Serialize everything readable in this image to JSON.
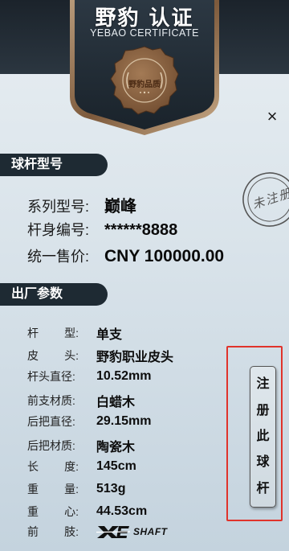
{
  "brand": {
    "title_cn": "野豹 认证",
    "title_en": "YEBAO CERTIFICATE",
    "seal_text": "野豹品质"
  },
  "close_label": "×",
  "stamp": {
    "text": "未注册"
  },
  "model_section": {
    "title": "球杆型号",
    "rows": [
      {
        "label": "系列型号:",
        "value": "巅峰"
      },
      {
        "label": "杆身编号:",
        "value": "******8888"
      },
      {
        "label": "统一售价:",
        "value": "CNY 100000.00"
      }
    ]
  },
  "factory_section": {
    "title": "出厂参数",
    "rows": [
      {
        "label_a": "杆",
        "label_b": "型:",
        "value": "单支"
      },
      {
        "label_a": "皮",
        "label_b": "头:",
        "value": "野豹职业皮头"
      },
      {
        "label": "杆头直径:",
        "value": "10.52mm"
      },
      {
        "label": "前支材质:",
        "value": "白蜡木"
      },
      {
        "label": "后把直径:",
        "value": "29.15mm"
      },
      {
        "label": "后把材质:",
        "value": "陶瓷木"
      },
      {
        "label_a": "长",
        "label_b": "度:",
        "value": "145cm"
      },
      {
        "label_a": "重",
        "label_b": "量:",
        "value": "513g"
      },
      {
        "label_a": "重",
        "label_b": "心:",
        "value": "44.53cm"
      },
      {
        "label_a": "前",
        "label_b": "肢:",
        "value": "SHAFT",
        "logo_icon": "xe-shaft-logo-icon"
      }
    ]
  },
  "register_button": {
    "chars": [
      "注",
      "册",
      "此",
      "球",
      "杆"
    ]
  },
  "colors": {
    "header_dark": "#1e2a33",
    "highlight_red": "#e0332b",
    "badge_bronze": "#8a6a4a"
  }
}
